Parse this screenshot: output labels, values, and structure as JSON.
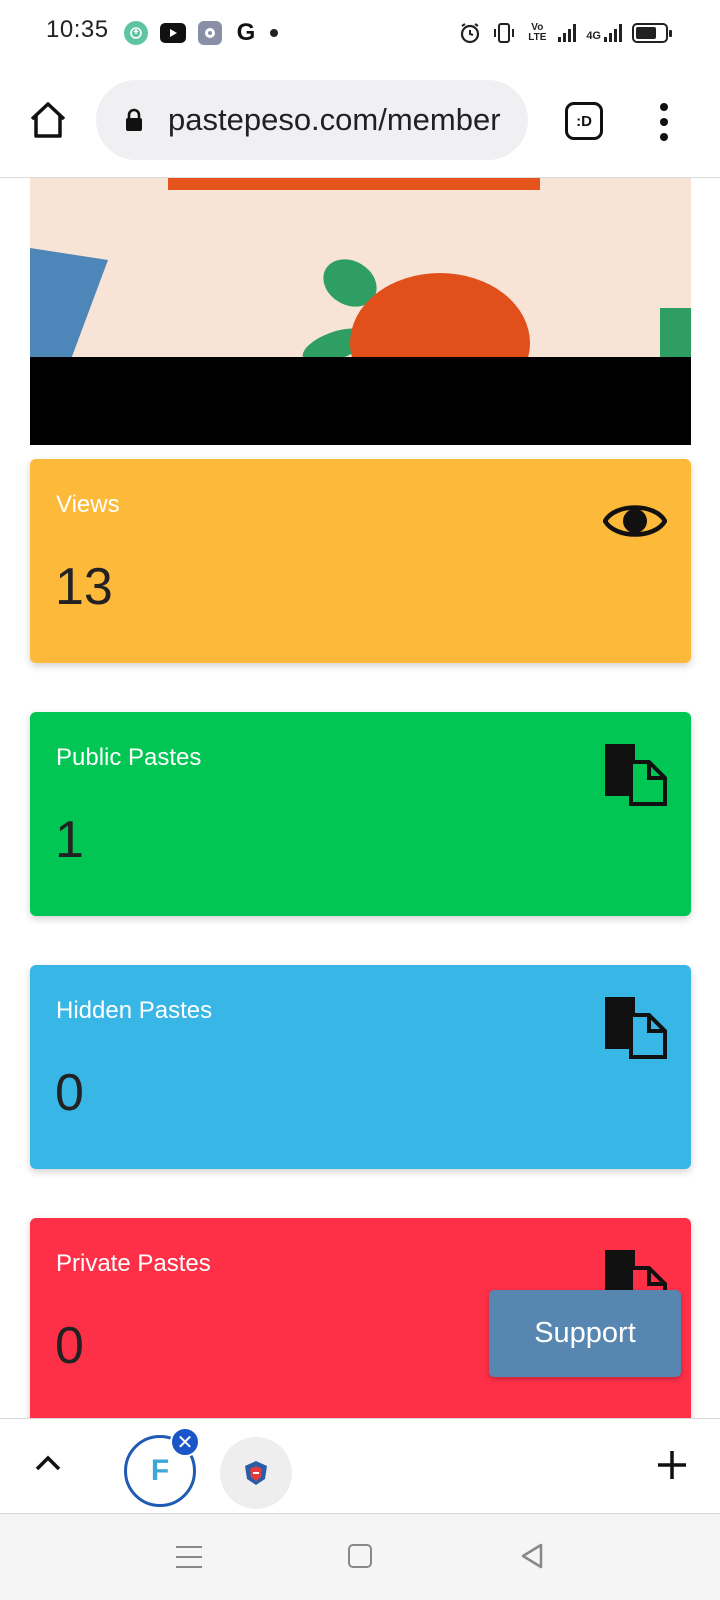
{
  "status_bar": {
    "time": "10:35",
    "notification_icons": [
      "green-app-icon",
      "youtube-icon",
      "settings-app-icon",
      "google-icon",
      "more-dot-icon"
    ],
    "system_icons": [
      "alarm-icon",
      "vibrate-icon",
      "volte-icon",
      "signal-icon",
      "4g-signal-icon",
      "battery-icon"
    ],
    "volte_label": "Vo LTE",
    "network_label": "4G"
  },
  "browser": {
    "url": "pastepeso.com/member",
    "tab_count_label": ":D"
  },
  "stats": [
    {
      "label": "Views",
      "value": "13",
      "color": "#fdb93a",
      "icon": "eye-icon"
    },
    {
      "label": "Public Pastes",
      "value": "1",
      "color": "#01c653",
      "icon": "pastes-icon"
    },
    {
      "label": "Hidden Pastes",
      "value": "0",
      "color": "#38b6e6",
      "icon": "pastes-icon"
    },
    {
      "label": "Private Pastes",
      "value": "0",
      "color": "#fe3048",
      "icon": "pastes-icon"
    }
  ],
  "support_button": {
    "label": "Support"
  },
  "tab_strip": {
    "avatar_letter": "F",
    "close_glyph": "✕",
    "new_tab_icon": "plus-icon"
  }
}
